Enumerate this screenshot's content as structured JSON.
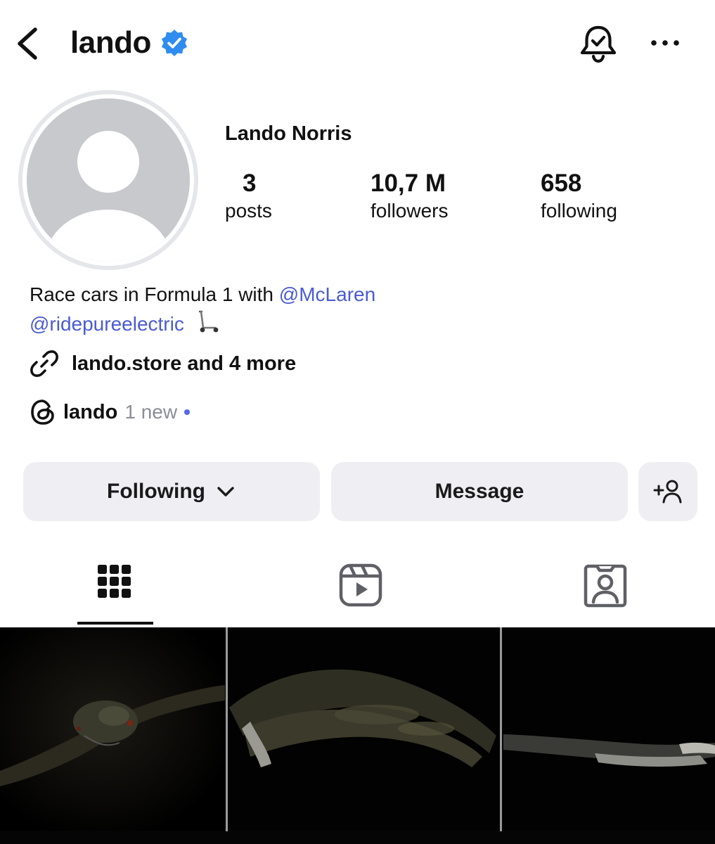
{
  "header": {
    "username": "lando",
    "back_icon": "chevron-left-icon",
    "verified_icon": "verified-badge-icon",
    "bell_icon": "bell-check-icon",
    "more_icon": "more-horizontal-icon"
  },
  "profile": {
    "full_name": "Lando Norris",
    "stats": [
      {
        "value": "3",
        "label": "posts"
      },
      {
        "value": "10,7 M",
        "label": "followers"
      },
      {
        "value": "658",
        "label": "following"
      }
    ]
  },
  "bio": {
    "text": "Race cars in Formula 1 with",
    "mention_1": "@McLaren",
    "mention_2": "@ridepureelectric",
    "emoji_icon": "kick-scooter-icon"
  },
  "link": {
    "icon": "link-icon",
    "text": "lando.store and 4 more"
  },
  "threads": {
    "icon": "threads-icon",
    "name": "lando",
    "new_text": "1 new"
  },
  "actions": {
    "following_label": "Following",
    "message_label": "Message",
    "add_icon": "add-person-icon"
  },
  "tabs": [
    {
      "icon": "grid-icon",
      "active": true
    },
    {
      "icon": "reels-icon",
      "active": false
    },
    {
      "icon": "tagged-icon",
      "active": false
    }
  ],
  "colors": {
    "mention": "#4a5bd4",
    "verified": "#2f8cf0",
    "button_bg": "#efeff3",
    "muted": "#8b8e95"
  }
}
